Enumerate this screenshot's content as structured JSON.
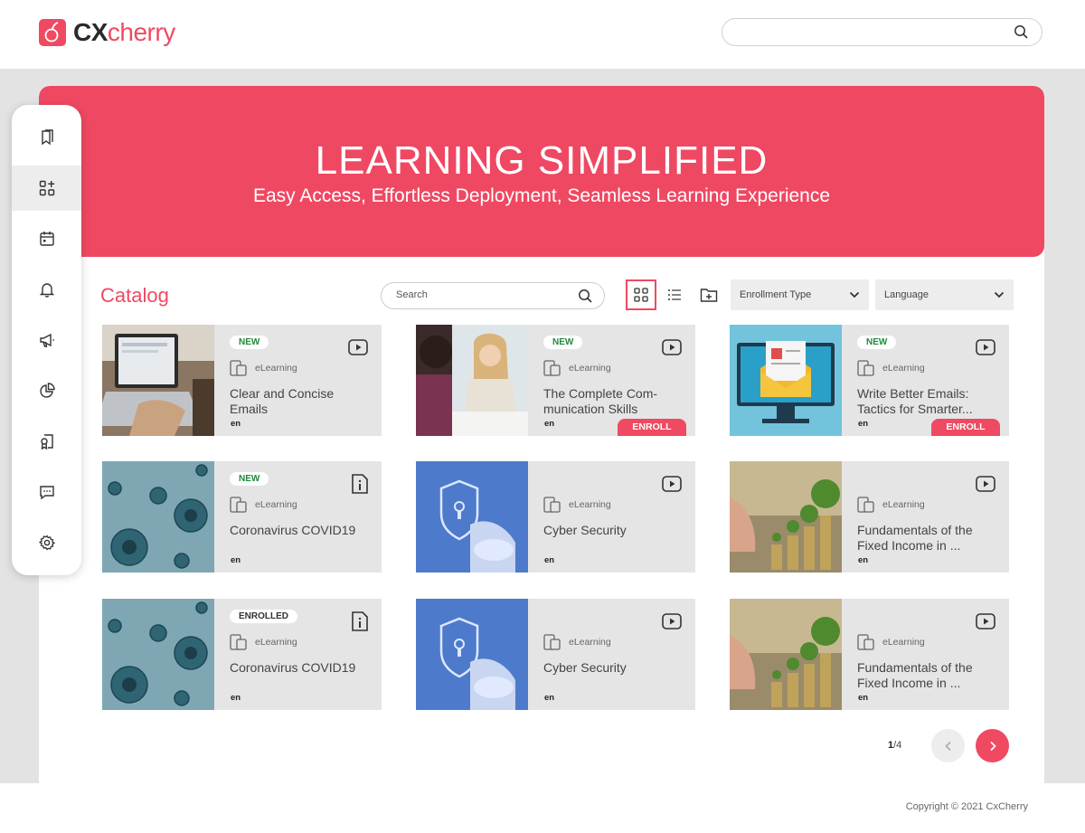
{
  "brand": {
    "name_bold": "CX",
    "name_rest": "cherry",
    "accent": "#ef4a62"
  },
  "header": {
    "search_placeholder": ""
  },
  "hero": {
    "title": "LEARNING SIMPLIFIED",
    "subtitle": "Easy Access, Effortless Deployment, Seamless Learning Experience",
    "color": "#ef4862"
  },
  "sidebar": {
    "items": [
      {
        "name": "bookmarks",
        "icon": "bookmark-icon"
      },
      {
        "name": "catalog",
        "icon": "grid-plus-icon",
        "active": true
      },
      {
        "name": "calendar",
        "icon": "calendar-icon"
      },
      {
        "name": "notifications",
        "icon": "bell-icon"
      },
      {
        "name": "announcements",
        "icon": "megaphone-icon"
      },
      {
        "name": "reports",
        "icon": "pie-chart-icon"
      },
      {
        "name": "certificates",
        "icon": "certificate-icon"
      },
      {
        "name": "messages",
        "icon": "chat-icon"
      },
      {
        "name": "settings",
        "icon": "gear-icon"
      }
    ]
  },
  "catalog": {
    "title": "Catalog",
    "search_placeholder": "Search",
    "filters": {
      "enrollment_type": "Enrollment Type",
      "language": "Language"
    },
    "cards": [
      {
        "badge": "NEW",
        "badge_type": "new",
        "type_icon": "video-icon",
        "kind": "eLearning",
        "title": "Clear and Concise Emails",
        "lang": "en",
        "enroll": ""
      },
      {
        "badge": "NEW",
        "badge_type": "new",
        "type_icon": "video-icon",
        "kind": "eLearning",
        "title": "The Complete Com-munication Skills",
        "lang": "en",
        "enroll": "ENROLL"
      },
      {
        "badge": "NEW",
        "badge_type": "new",
        "type_icon": "video-icon",
        "kind": "eLearning",
        "title": "Write Better Emails: Tactics for Smarter...",
        "lang": "en",
        "enroll": "ENROLL"
      },
      {
        "badge": "NEW",
        "badge_type": "new",
        "type_icon": "info-doc-icon",
        "kind": "eLearning",
        "title": "Coronavirus COVID19",
        "lang": "en",
        "enroll": ""
      },
      {
        "badge": "",
        "badge_type": "",
        "type_icon": "video-icon",
        "kind": "eLearning",
        "title": "Cyber Security",
        "lang": "en",
        "enroll": ""
      },
      {
        "badge": "",
        "badge_type": "",
        "type_icon": "video-icon",
        "kind": "eLearning",
        "title": "Fundamentals of the Fixed Income in ...",
        "lang": "en",
        "enroll": ""
      },
      {
        "badge": "ENROLLED",
        "badge_type": "enrolled",
        "type_icon": "info-doc-icon",
        "kind": "eLearning",
        "title": "Coronavirus COVID19",
        "lang": "en",
        "enroll": ""
      },
      {
        "badge": "",
        "badge_type": "",
        "type_icon": "video-icon",
        "kind": "eLearning",
        "title": "Cyber Security",
        "lang": "en",
        "enroll": ""
      },
      {
        "badge": "",
        "badge_type": "",
        "type_icon": "video-icon",
        "kind": "eLearning",
        "title": "Fundamentals of the Fixed Income in ...",
        "lang": "en",
        "enroll": ""
      }
    ]
  },
  "pagination": {
    "current": "1",
    "total": "/4"
  },
  "footer": {
    "copyright": "Copyright © 2021 CxCherry"
  }
}
